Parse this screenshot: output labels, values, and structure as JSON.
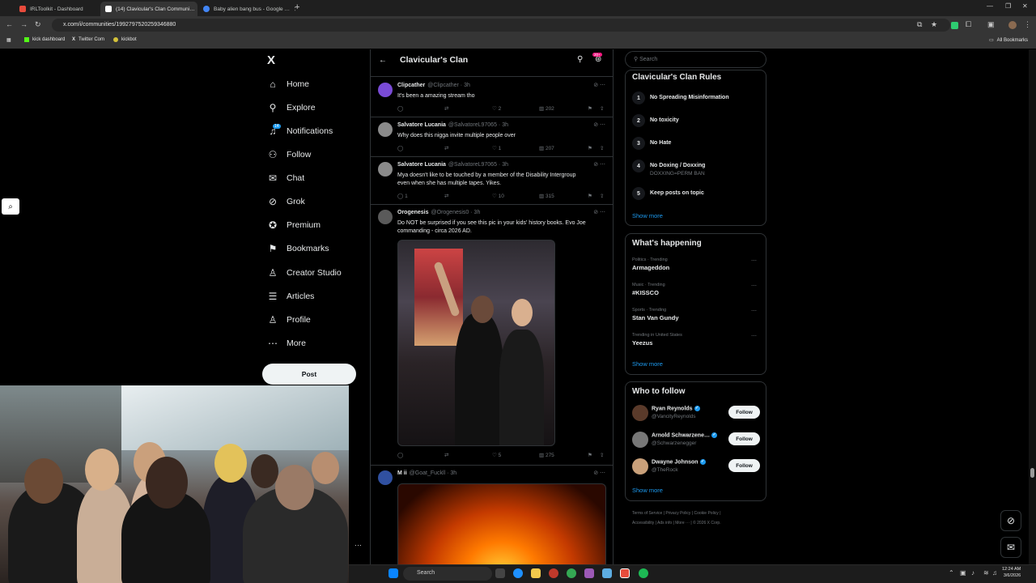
{
  "browser": {
    "tabs": [
      {
        "label": "IRLToolkit - Dashboard",
        "color": "#e94b3c"
      },
      {
        "label": "(14) Clavicular's Clan Communi…",
        "color": "#ffffff"
      },
      {
        "label": "Baby alien bang bus - Google …",
        "color": "#4285f4"
      }
    ],
    "new_tab": "+",
    "url": "x.com/i/communities/1992797520259346880",
    "bookmarks": [
      "kick dashboard",
      "Twitter Com",
      "kickbot"
    ],
    "all_bookmarks": "All Bookmarks"
  },
  "sidebar": {
    "logo": "X",
    "notif_badge": "14",
    "items": [
      {
        "label": "Home",
        "icon": "home-icon",
        "glyph": "⌂"
      },
      {
        "label": "Explore",
        "icon": "search-icon",
        "glyph": "⚲"
      },
      {
        "label": "Notifications",
        "icon": "bell-icon",
        "glyph": "♫"
      },
      {
        "label": "Follow",
        "icon": "add-person-icon",
        "glyph": "⚇"
      },
      {
        "label": "Chat",
        "icon": "mail-icon",
        "glyph": "✉"
      },
      {
        "label": "Grok",
        "icon": "grok-icon",
        "glyph": "⊘"
      },
      {
        "label": "Premium",
        "icon": "premium-icon",
        "glyph": "✪"
      },
      {
        "label": "Bookmarks",
        "icon": "bookmark-icon",
        "glyph": "⚑"
      },
      {
        "label": "Creator Studio",
        "icon": "creator-icon",
        "glyph": "♙"
      },
      {
        "label": "Articles",
        "icon": "articles-icon",
        "glyph": "☰"
      },
      {
        "label": "Profile",
        "icon": "profile-icon",
        "glyph": "♙"
      },
      {
        "label": "More",
        "icon": "more-icon",
        "glyph": "⋯"
      }
    ],
    "post_label": "Post"
  },
  "header": {
    "title": "Clavicular's Clan",
    "badge": "20+"
  },
  "tweets": [
    {
      "name": "Clipcather",
      "handle": "@Clipcather",
      "time": "3h",
      "text": [
        "It's been a amazing stream tho"
      ],
      "likes": "2",
      "views": "202",
      "replies": "",
      "reposts": "",
      "avatar": "#7a4bd6"
    },
    {
      "name": "Salvatore Lucania",
      "handle": "@SalvatoreL97065",
      "time": "3h",
      "text": [
        "Why does this nigga invite multiple people over"
      ],
      "likes": "1",
      "views": "207",
      "replies": "",
      "reposts": "",
      "avatar": "#8a8a8a"
    },
    {
      "name": "Salvatore Lucania",
      "handle": "@SalvatoreL97065",
      "time": "3h",
      "text": [
        "Mya doesn't like to be touched by a member of the Disability Intergroup",
        "even when she has multiple tapes. Yikes."
      ],
      "likes": "10",
      "views": "315",
      "replies": "1",
      "reposts": "",
      "avatar": "#8a8a8a"
    },
    {
      "name": "Orogenesis",
      "handle": "@Orogenesis0",
      "time": "3h",
      "text": [
        "Do NOT be surprised if you see this pic in your kids' history books.  Evo Joe",
        "commanding - circa 2026 AD."
      ],
      "likes": "5",
      "views": "275",
      "replies": "",
      "reposts": "",
      "avatar": "#5a5a5a"
    },
    {
      "name": "M ii",
      "handle": "@Goat_Fuckll",
      "time": "3h",
      "text": [],
      "avatar": "#3050a0"
    }
  ],
  "right": {
    "search_placeholder": "Search",
    "rules_title": "Clavicular's Clan Rules",
    "rules": [
      {
        "num": "1",
        "label": "No Spreading Misinformation",
        "sub": ""
      },
      {
        "num": "2",
        "label": "No toxicity",
        "sub": ""
      },
      {
        "num": "3",
        "label": "No Hate",
        "sub": ""
      },
      {
        "num": "4",
        "label": "No Doxing / Doxxing",
        "sub": "DOXXING=PERM BAN"
      },
      {
        "num": "5",
        "label": "Keep posts on topic",
        "sub": ""
      }
    ],
    "show_more": "Show more",
    "happening_title": "What's happening",
    "trends": [
      {
        "category": "Politics · Trending",
        "name": "Armageddon"
      },
      {
        "category": "Music · Trending",
        "name": "#KISSCO"
      },
      {
        "category": "Sports · Trending",
        "name": "Stan Van Gundy"
      },
      {
        "category": "Trending in United States",
        "name": "Yeezus"
      }
    ],
    "wtf_title": "Who to follow",
    "follow_label": "Follow",
    "who_to_follow": [
      {
        "name": "Ryan Reynolds",
        "handle": "@VancityReynolds",
        "avatar": "#5a3a2a"
      },
      {
        "name": "Arnold Schwarzene…",
        "handle": "@Schwarzenegger",
        "avatar": "#777"
      },
      {
        "name": "Dwayne Johnson",
        "handle": "@TheRock",
        "avatar": "#c9a07a"
      }
    ],
    "footer": [
      "Terms of Service",
      "Privacy Policy",
      "Cookie Policy",
      "Accessibility",
      "Ads info",
      "More ···",
      "© 2026 X Corp."
    ]
  },
  "taskbar": {
    "search_placeholder": "Search",
    "time": "12:24 AM",
    "date": "3/6/2026"
  }
}
